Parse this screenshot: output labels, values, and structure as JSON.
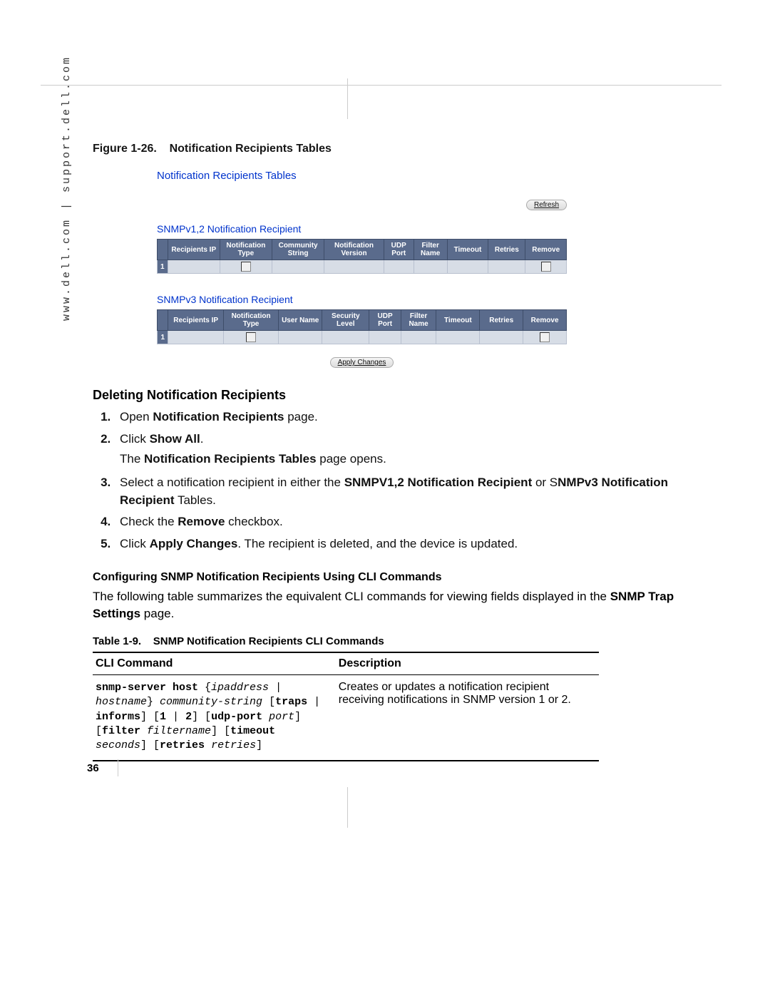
{
  "side_text": "www.dell.com | support.dell.com",
  "fig_caption_no": "Figure 1-26.",
  "fig_caption_title": "Notification Recipients Tables",
  "screenshot": {
    "title": "Notification Recipients Tables",
    "refresh": "Refresh",
    "section1_title": "SNMPv1,2 Notification Recipient",
    "table1": {
      "headers": [
        "Recipients IP",
        "Notification Type",
        "Community String",
        "Notification Version",
        "UDP Port",
        "Filter Name",
        "Timeout",
        "Retries",
        "Remove"
      ],
      "row_num": "1"
    },
    "section2_title": "SNMPv3 Notification Recipient",
    "table2": {
      "headers": [
        "Recipients IP",
        "Notification Type",
        "User Name",
        "Security Level",
        "UDP Port",
        "Filter Name",
        "Timeout",
        "Retries",
        "Remove"
      ],
      "row_num": "1"
    },
    "apply": "Apply Changes"
  },
  "deleting": {
    "heading": "Deleting Notification Recipients",
    "step1_a": "Open ",
    "step1_b": "Notification Recipients",
    "step1_c": " page.",
    "step2_a": "Click ",
    "step2_b": "Show All",
    "step2_c": ".",
    "step2_para_a": "The ",
    "step2_para_b": "Notification Recipients Tables",
    "step2_para_c": " page opens.",
    "step3_a": "Select a notification recipient in either the ",
    "step3_b": "SNMPV1,2 Notification Recipient",
    "step3_c": " or S",
    "step3_d": "NMPv3 Notification Recipient",
    "step3_e": " Tables.",
    "step4_a": "Check the ",
    "step4_b": "Remove",
    "step4_c": " checkbox.",
    "step5_a": "Click ",
    "step5_b": "Apply Changes",
    "step5_c": ". The recipient is deleted, and the device is updated."
  },
  "cli": {
    "heading": "Configuring SNMP Notification Recipients Using CLI Commands",
    "intro_a": "The following table summarizes the equivalent CLI commands for viewing fields displayed in the ",
    "intro_b": "SNMP Trap Settings",
    "intro_c": " page.",
    "table_caption_no": "Table 1-9.",
    "table_caption_title": "SNMP Notification Recipients CLI Commands",
    "col1": "CLI Command",
    "col2": "Description",
    "cmd": {
      "p1_a": "snmp-server host",
      "p1_b": " {",
      "p1_c": "ipaddress",
      "p1_d": " | ",
      "p1_e": "hostname",
      "p1_f": "} ",
      "p1_g": "community-string",
      "p1_h": " [",
      "p1_i": "traps",
      "p1_j": " | ",
      "p1_k": "informs",
      "p1_l": "] [",
      "p1_m": "1",
      "p1_n": " | ",
      "p1_o": "2",
      "p1_p": "] [",
      "p1_q": "udp-port",
      "p1_r": " ",
      "p1_s": "port",
      "p1_t": "] [",
      "p1_u": "filter",
      "p1_v": " ",
      "p1_w": "filtername",
      "p1_x": "] [",
      "p1_y": "timeout",
      "p1_z": " ",
      "p1_aa": "seconds",
      "p1_ab": "] [",
      "p1_ac": "retries",
      "p1_ad": " ",
      "p1_ae": "retries",
      "p1_af": "]"
    },
    "desc": "Creates or updates a notification recipient receiving notifications in SNMP version 1 or 2."
  },
  "page_number": "36"
}
